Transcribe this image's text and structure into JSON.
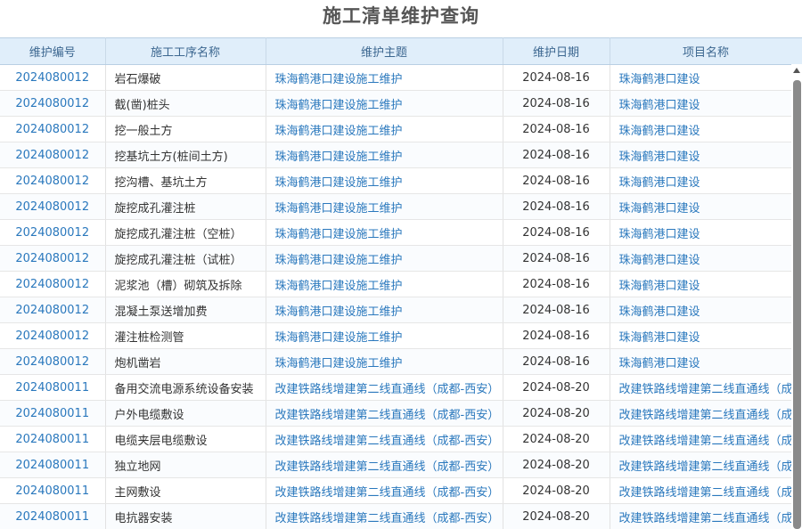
{
  "page": {
    "title": "施工清单维护查询"
  },
  "table": {
    "columns": [
      "维护编号",
      "施工工序名称",
      "维护主题",
      "维护日期",
      "项目名称"
    ],
    "rows": [
      {
        "id": "2024080012",
        "process": "岩石爆破",
        "subject": "珠海鹤港口建设施工维护",
        "date": "2024-08-16",
        "project": "珠海鹤港口建设"
      },
      {
        "id": "2024080012",
        "process": "截(凿)桩头",
        "subject": "珠海鹤港口建设施工维护",
        "date": "2024-08-16",
        "project": "珠海鹤港口建设"
      },
      {
        "id": "2024080012",
        "process": "挖一般土方",
        "subject": "珠海鹤港口建设施工维护",
        "date": "2024-08-16",
        "project": "珠海鹤港口建设"
      },
      {
        "id": "2024080012",
        "process": "挖基坑土方(桩间土方)",
        "subject": "珠海鹤港口建设施工维护",
        "date": "2024-08-16",
        "project": "珠海鹤港口建设"
      },
      {
        "id": "2024080012",
        "process": "挖沟槽、基坑土方",
        "subject": "珠海鹤港口建设施工维护",
        "date": "2024-08-16",
        "project": "珠海鹤港口建设"
      },
      {
        "id": "2024080012",
        "process": "旋挖成孔灌注桩",
        "subject": "珠海鹤港口建设施工维护",
        "date": "2024-08-16",
        "project": "珠海鹤港口建设"
      },
      {
        "id": "2024080012",
        "process": "旋挖成孔灌注桩（空桩）",
        "subject": "珠海鹤港口建设施工维护",
        "date": "2024-08-16",
        "project": "珠海鹤港口建设"
      },
      {
        "id": "2024080012",
        "process": "旋挖成孔灌注桩（试桩）",
        "subject": "珠海鹤港口建设施工维护",
        "date": "2024-08-16",
        "project": "珠海鹤港口建设"
      },
      {
        "id": "2024080012",
        "process": "泥浆池（槽）砌筑及拆除",
        "subject": "珠海鹤港口建设施工维护",
        "date": "2024-08-16",
        "project": "珠海鹤港口建设"
      },
      {
        "id": "2024080012",
        "process": "混凝土泵送增加费",
        "subject": "珠海鹤港口建设施工维护",
        "date": "2024-08-16",
        "project": "珠海鹤港口建设"
      },
      {
        "id": "2024080012",
        "process": "灌注桩检测管",
        "subject": "珠海鹤港口建设施工维护",
        "date": "2024-08-16",
        "project": "珠海鹤港口建设"
      },
      {
        "id": "2024080012",
        "process": "炮机凿岩",
        "subject": "珠海鹤港口建设施工维护",
        "date": "2024-08-16",
        "project": "珠海鹤港口建设"
      },
      {
        "id": "2024080011",
        "process": "备用交流电源系统设备安装",
        "subject": "改建铁路线增建第二线直通线（成都-西安）",
        "date": "2024-08-20",
        "project": "改建铁路线增建第二线直通线（成"
      },
      {
        "id": "2024080011",
        "process": "户外电缆敷设",
        "subject": "改建铁路线增建第二线直通线（成都-西安）",
        "date": "2024-08-20",
        "project": "改建铁路线增建第二线直通线（成"
      },
      {
        "id": "2024080011",
        "process": "电缆夹层电缆敷设",
        "subject": "改建铁路线增建第二线直通线（成都-西安）",
        "date": "2024-08-20",
        "project": "改建铁路线增建第二线直通线（成"
      },
      {
        "id": "2024080011",
        "process": "独立地网",
        "subject": "改建铁路线增建第二线直通线（成都-西安）",
        "date": "2024-08-20",
        "project": "改建铁路线增建第二线直通线（成"
      },
      {
        "id": "2024080011",
        "process": "主网敷设",
        "subject": "改建铁路线增建第二线直通线（成都-西安）",
        "date": "2024-08-20",
        "project": "改建铁路线增建第二线直通线（成"
      },
      {
        "id": "2024080011",
        "process": "电抗器安装",
        "subject": "改建铁路线增建第二线直通线（成都-西安）",
        "date": "2024-08-20",
        "project": "改建铁路线增建第二线直通线（成"
      }
    ]
  },
  "scrollbar": {
    "up_icon": "arrow-up-icon"
  }
}
